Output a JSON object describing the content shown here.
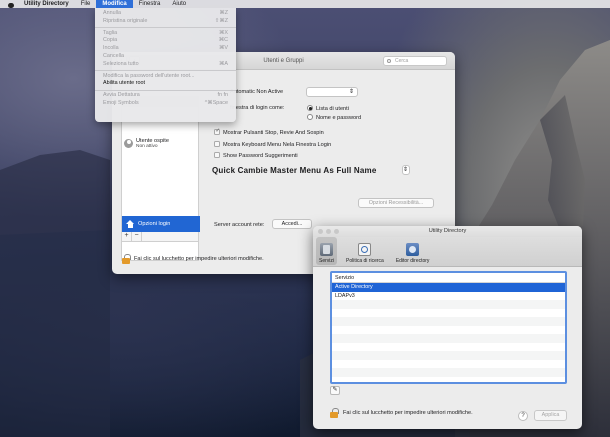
{
  "menubar": {
    "app_name": "Utility Directory",
    "items": [
      "File",
      "Modifica",
      "Finestra",
      "Aiuto"
    ]
  },
  "edit_menu": {
    "items": [
      {
        "label": "Annulla",
        "shortcut": "⌘Z",
        "enabled": false
      },
      {
        "label": "Ripristina originale",
        "shortcut": "⇧⌘Z",
        "enabled": false
      },
      {
        "sep": true
      },
      {
        "label": "Taglia",
        "shortcut": "⌘X",
        "enabled": false
      },
      {
        "label": "Copia",
        "shortcut": "⌘C",
        "enabled": false
      },
      {
        "label": "Incolla",
        "shortcut": "⌘V",
        "enabled": false
      },
      {
        "label": "Cancella",
        "shortcut": "",
        "enabled": false
      },
      {
        "label": "Seleziona tutto",
        "shortcut": "⌘A",
        "enabled": false
      },
      {
        "sep": true
      },
      {
        "label": "Modifica la password dell'utente root...",
        "shortcut": "",
        "enabled": false
      },
      {
        "label": "Abilita utente root",
        "shortcut": "",
        "enabled": true
      },
      {
        "sep": true
      },
      {
        "label": "Avvia Dettatura",
        "shortcut": "fn fn",
        "enabled": false
      },
      {
        "label": "Emoji Symbols",
        "shortcut": "^⌘Space",
        "enabled": false
      }
    ]
  },
  "prefs_window": {
    "title": "Utenti e Gruppi",
    "search_placeholder": "Cerca",
    "guest_user": {
      "name": "Utente ospite",
      "status": "Non attivo"
    },
    "login_options_label": "Opzioni login",
    "automatic_login_label": "Automatic Non Active",
    "login_window_label": "finestra di login come:",
    "radio_users_list": "Lista di utenti",
    "radio_name_password": "Nome e password",
    "check_1": "Mostrar Pulsanti Stop, Revie And Sospin",
    "check_2": "Mostra Keyboard Menu Nela Finestra Login",
    "check_3": "Show Password Suggerimenti",
    "fast_switch_label": "Quick Cambie Master Menu As Full Name",
    "accessibility_button": "Opzioni Recessibilità...",
    "network_account_label": "Server account rete:",
    "join_button": "Accedi...",
    "lock_message": "Fai clic sul lucchetto per impedire ulteriori modifiche."
  },
  "utility_window": {
    "title": "Utility Directory",
    "tabs": [
      "Servizi",
      "Politica di ricerca",
      "Editor directory"
    ],
    "table": {
      "header": "Servizio",
      "rows": [
        "Active Directory",
        "LDAPv3"
      ]
    },
    "lock_message": "Fai clic sul lucchetto per impedire ulteriori modifiche.",
    "help_label": "?",
    "apply_button": "Applica"
  },
  "colors": {
    "selection_blue": "#1f64d6",
    "lock_orange": "#e39a2a"
  }
}
